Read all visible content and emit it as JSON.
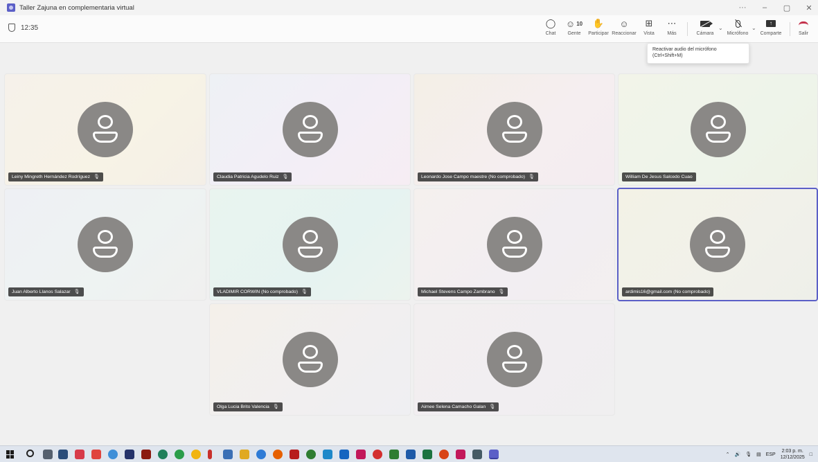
{
  "window": {
    "title": "Taller Zajuna en complementaria virtual",
    "controls": [
      "···",
      "–",
      "▢",
      "✕"
    ]
  },
  "meeting": {
    "timer": "12:35",
    "people_count": "10"
  },
  "toolbar": {
    "chat_label": "Chat",
    "people_label": "Gente",
    "raise_label": "Participar",
    "react_label": "Reaccionar",
    "view_label": "Vista",
    "more_label": "Más",
    "camera_label": "Cámara",
    "mic_label": "Micrófono",
    "share_label": "Comparte",
    "leave_label": "Salir"
  },
  "tooltip": {
    "line1": "Reactivar audio del micrófono",
    "line2": "(Ctrl+Shift+M)"
  },
  "participants": [
    {
      "name": "Leiny Mingreth Hernández Rodríguez"
    },
    {
      "name": "Claudia Patricia Agudelo Ruiz"
    },
    {
      "name": "Leonardo Jose Campo maestre (No comprobado)"
    },
    {
      "name": "William De Jesus Salcedo Cuao"
    },
    {
      "name": "Juan Alberto Llanos Salazar"
    },
    {
      "name": "VLADIMIR CORWIN (No comprobado)"
    },
    {
      "name": "Michael Stevens Campo Zambrano"
    },
    {
      "name": "ardimis16@gmail.com (No comprobado)"
    },
    {
      "name": "Olga Lucia Brito Valencia"
    },
    {
      "name": "Aimee Selena Camacho Galan"
    }
  ],
  "taskbar": {
    "language": "ESP",
    "time": "2:03 p. m.",
    "date": "12/12/2025"
  },
  "colors": {
    "accent": "#5b5fc7",
    "leave": "#c4314b",
    "avatar": "#8a8886"
  }
}
